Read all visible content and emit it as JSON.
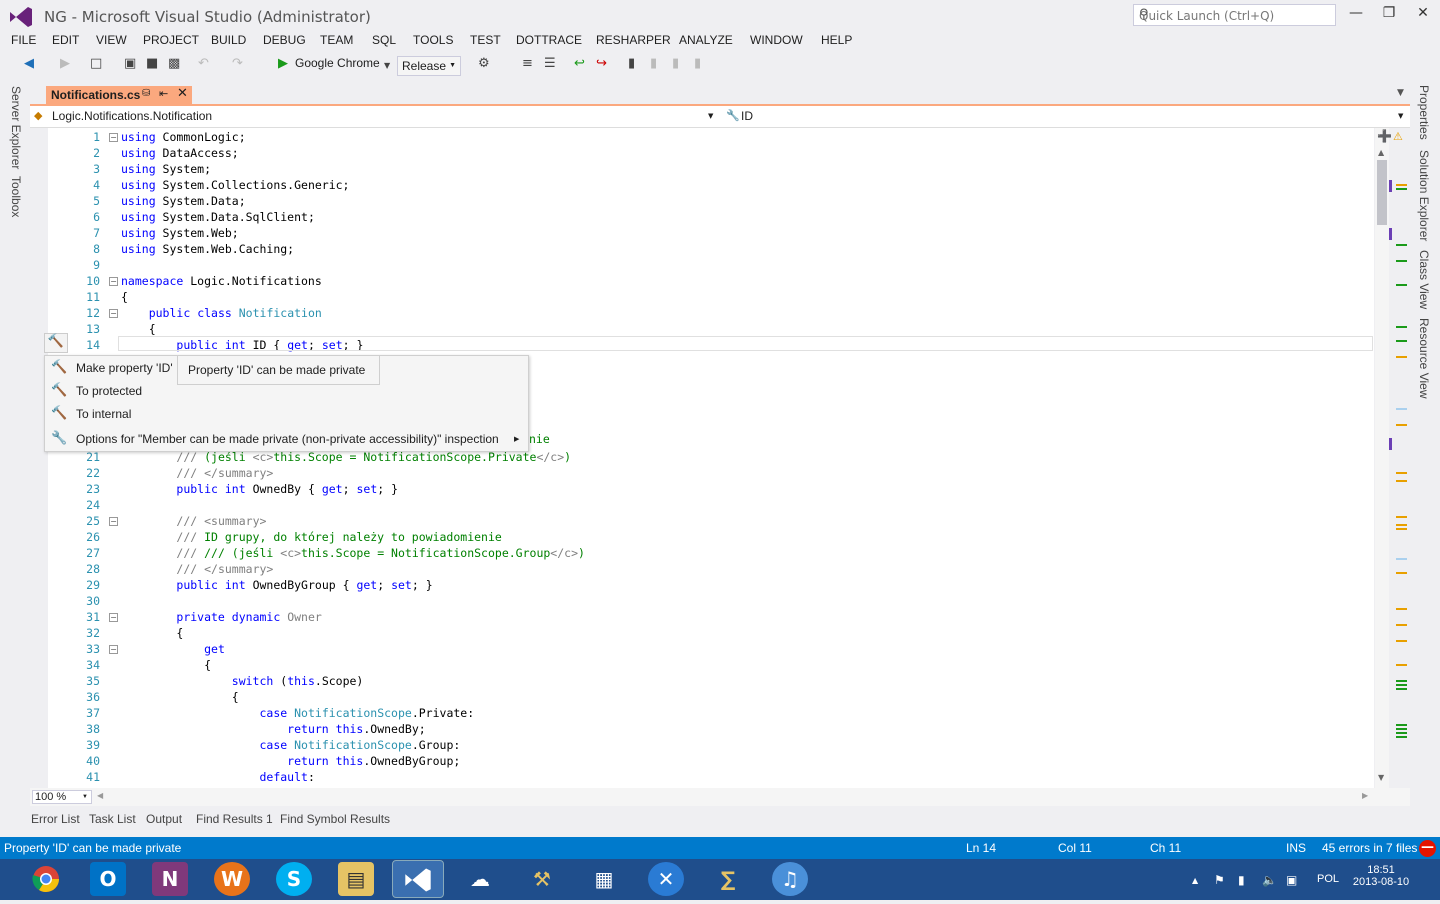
{
  "window": {
    "title": "NG - Microsoft Visual Studio (Administrator)",
    "quick_launch_placeholder": "Quick Launch (Ctrl+Q)"
  },
  "menu": [
    "FILE",
    "EDIT",
    "VIEW",
    "PROJECT",
    "BUILD",
    "DEBUG",
    "TEAM",
    "SQL",
    "TOOLS",
    "TEST",
    "DOTTRACE",
    "RESHARPER",
    "ANALYZE",
    "WINDOW",
    "HELP"
  ],
  "toolbar": {
    "run_target": "Google Chrome",
    "configuration": "Release"
  },
  "side_left": [
    "Server Explorer",
    "Toolbox"
  ],
  "side_right": [
    "Properties",
    "Solution Explorer",
    "Class View",
    "Resource View"
  ],
  "document_tab": {
    "label": "Notifications.cs"
  },
  "navbar": {
    "type": "Logic.Notifications.Notification",
    "member": "ID"
  },
  "popup": {
    "tooltip": "Property 'ID' can be made private",
    "items": [
      "Make property 'ID'",
      "To protected",
      "To internal",
      "Options for \"Member can be made private (non-private accessibility)\" inspection"
    ]
  },
  "code_lines": [
    {
      "n": "1",
      "t": "using CommonLogic;"
    },
    {
      "n": "2",
      "t": "using DataAccess;"
    },
    {
      "n": "3",
      "t": "using System;"
    },
    {
      "n": "4",
      "t": "using System.Collections.Generic;"
    },
    {
      "n": "5",
      "t": "using System.Data;"
    },
    {
      "n": "6",
      "t": "using System.Data.SqlClient;"
    },
    {
      "n": "7",
      "t": "using System.Web;"
    },
    {
      "n": "8",
      "t": "using System.Web.Caching;"
    },
    {
      "n": "9",
      "t": ""
    },
    {
      "n": "10",
      "t": "namespace Logic.Notifications"
    },
    {
      "n": "11",
      "t": "{"
    },
    {
      "n": "12",
      "t": "    public class Notification"
    },
    {
      "n": "13",
      "t": "    {"
    },
    {
      "n": "14",
      "t": "        public int ID { get; set; }"
    },
    {
      "n": "21",
      "t": "        /// (jeśli <c>this.Scope = NotificationScope.Private</c>)"
    },
    {
      "n": "22",
      "t": "        /// </summary>"
    },
    {
      "n": "23",
      "t": "        public int OwnedBy { get; set; }"
    },
    {
      "n": "24",
      "t": ""
    },
    {
      "n": "25",
      "t": "        /// <summary>"
    },
    {
      "n": "26",
      "t": "        /// ID grupy, do której należy to powiadomienie"
    },
    {
      "n": "27",
      "t": "        /// /// (jeśli <c>this.Scope = NotificationScope.Group</c>)"
    },
    {
      "n": "28",
      "t": "        /// </summary>"
    },
    {
      "n": "29",
      "t": "        public int OwnedByGroup { get; set; }"
    },
    {
      "n": "30",
      "t": ""
    },
    {
      "n": "31",
      "t": "        private dynamic Owner"
    },
    {
      "n": "32",
      "t": "        {"
    },
    {
      "n": "33",
      "t": "            get"
    },
    {
      "n": "34",
      "t": "            {"
    },
    {
      "n": "35",
      "t": "                switch (this.Scope)"
    },
    {
      "n": "36",
      "t": "                {"
    },
    {
      "n": "37",
      "t": "                    case NotificationScope.Private:"
    },
    {
      "n": "38",
      "t": "                        return this.OwnedBy;"
    },
    {
      "n": "39",
      "t": "                    case NotificationScope.Group:"
    },
    {
      "n": "40",
      "t": "                        return this.OwnedByGroup;"
    },
    {
      "n": "41",
      "t": "                    default:"
    }
  ],
  "hidden_fragment": "nie",
  "zoom": "100 %",
  "bottom_tabs": [
    "Error List",
    "Task List",
    "Output",
    "Find Results 1",
    "Find Symbol Results"
  ],
  "status": {
    "message": "Property 'ID' can be made private",
    "ln": "Ln 14",
    "col": "Col 11",
    "ch": "Ch 11",
    "mode": "INS",
    "errors": "45 errors in 7 files"
  },
  "tray": {
    "lang": "POL",
    "time": "18:51",
    "date": "2013-08-10"
  },
  "colors": {
    "accent": "#007acc",
    "tab": "#fba87e",
    "taskbar": "#1f4e8c"
  }
}
